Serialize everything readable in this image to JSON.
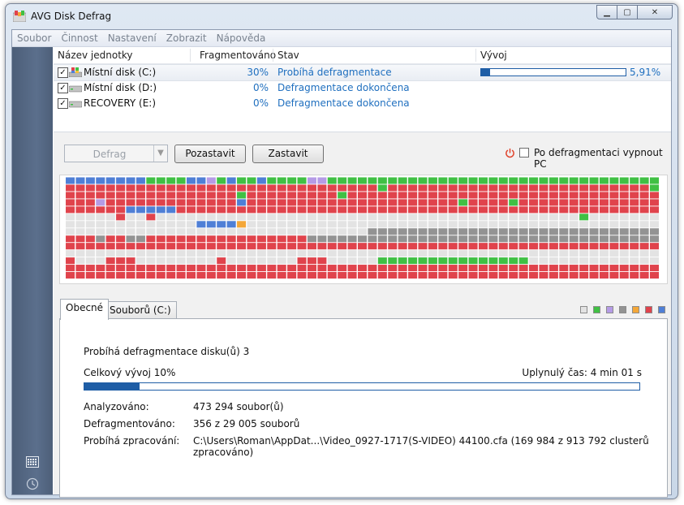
{
  "window": {
    "title": "AVG Disk Defrag"
  },
  "menu": [
    "Soubor",
    "Činnost",
    "Nastavení",
    "Zobrazit",
    "Nápověda"
  ],
  "table": {
    "headers": {
      "name": "Název jednotky",
      "frag": "Fragmentováno",
      "status": "Stav",
      "progress": "Vývoj"
    },
    "rows": [
      {
        "name": "Místní disk (C:)",
        "frag": "30%",
        "status": "Probíhá defragmentace",
        "progress_text": "5,91%",
        "progress": 0.0591,
        "checked": true
      },
      {
        "name": "Místní disk (D:)",
        "frag": "0%",
        "status": "Defragmentace dokončena",
        "checked": true
      },
      {
        "name": "RECOVERY (E:)",
        "frag": "0%",
        "status": "Defragmentace dokončena",
        "checked": true
      }
    ]
  },
  "toolbar": {
    "defrag_label": "Defrag",
    "pause_label": "Pozastavit",
    "stop_label": "Zastavit",
    "shutdown_label": "Po defragmentaci vypnout PC",
    "shutdown_checked": false
  },
  "colors": {
    "fragmented": "#e0434c",
    "contiguous": "#40c044",
    "unmovable": "#939393",
    "free": "#e3e3e3",
    "system": "#4f7fd6",
    "meta": "#b59be6",
    "processing": "#f4a738",
    "accent": "#1f5ea6"
  },
  "legend_colors": [
    "#e3e3e3",
    "#40c044",
    "#b59be6",
    "#939393",
    "#f4a738",
    "#e0434c",
    "#4f7fd6"
  ],
  "tabs": [
    "Obecné",
    "Souborů (C:)"
  ],
  "general": {
    "heading": "Probíhá defragmentace disku(ů) 3",
    "overall_label": "Celkový vývoj 10%",
    "overall_progress": 0.1,
    "elapsed": "Uplynulý čas: 4 min 01 s",
    "analyzed_label": "Analyzováno:",
    "analyzed_value": "473 294 soubor(ů)",
    "defragmented_label": "Defragmentováno:",
    "defragmented_value": "356 z 29 005 souborů",
    "processing_label": "Probíhá zpracování:",
    "processing_value": "C:\\Users\\Roman\\AppDat...\\Video_0927-1717(S-VIDEO) 44100.cfa (169 984 z 913 792 clusterů zpracováno)"
  },
  "cluster_map": {
    "columns": 59,
    "rows": 14,
    "legend": "g=free-space, G=defragmented, R=fragmented, D=unmovable, B=system, P=metadata, O=in-progress",
    "data": [
      "BBBBBBBBGGGGBBPGBGGBGGGGPPGGGGGGGGGGGGGGGGGGGGGGGGGGGGGGGGG",
      "RRRRRRRRRRRRRRRRRRRRRRRRRRRRRRRGRRRRRRRRRRRRRRRRRRRRRRRRRRG",
      "RRRRRRRRRRRRRRRRRGRRRRRRRRRGRRRRRRRRRRRRRRRRRRRRRRRRRRRRRRR",
      "RRRPRRRRRRRRRRRRRBRRRRRRRRRRRRRRRRRRRRRGRRRRGRRRRRRRRRRRRRR",
      "RRRRRRBBBBBRRRRRRRRRRRRRRRRRRRRRRRRRRRRRRRRRRRRRRRRRRRRRRRR",
      "gggggRggRggggggggggggggggggggggggggggggggggggggggggGggggggg",
      "gggggggggggggBBBBOgggggggggggggggggggggggggggggggggggggggggg",
      "ggggggggggggggggggggggggggggggDDDDDDDDDDDDDDDDDDDDDDDDDDDDD",
      "RRRDRRDDRRRRRRRRRRRRRRRRDDDDDDDDDDDDDDDDDDDDDDDDDDDDDDDDDDDD",
      "RRRRRRRRRRRRRRRRRRRRRRRRRRRRRRRRRRRRRRRRRRRRRRRRRRRRRRRRRRR",
      "ggggggggggggggggggggggggggggggggggggggggggggggggggggggggggg",
      "RgggRRRggggggggRgggggggRRRgggggGGGGGGGGGGGGGGGggggggggggggg",
      "RRRRRRRRRRRRRRRRRRRRRRRRRRRRRRRRRRRRRRRRRRRRRRRRRRRRRRRRRRR",
      "RRRRRRRRRRRRRRRRRRRRRRRRRRRRRRRRRRRRRRRRRRRRRRRRRRRRRRRRRRR"
    ]
  }
}
